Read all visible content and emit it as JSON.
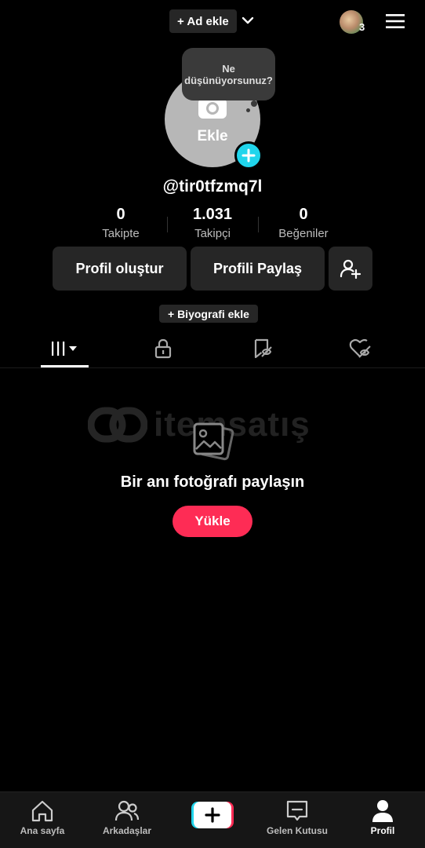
{
  "header": {
    "add_name_label": "+ Ad ekle",
    "notification_count": "3"
  },
  "profile": {
    "bubble_text": "Ne düşünüyorsunuz?",
    "avatar_label": "Ekle",
    "username": "@tir0tfzmq7l",
    "bio_button": "+ Biyografi ekle"
  },
  "stats": [
    {
      "value": "0",
      "label": "Takipte"
    },
    {
      "value": "1.031",
      "label": "Takipçi"
    },
    {
      "value": "0",
      "label": "Beğeniler"
    }
  ],
  "actions": {
    "edit_profile": "Profil oluştur",
    "share_profile": "Profili Paylaş"
  },
  "tabs": [
    {
      "icon": "grid-icon",
      "active": true
    },
    {
      "icon": "lock-icon",
      "active": false
    },
    {
      "icon": "bookmark-icon",
      "active": false
    },
    {
      "icon": "liked-icon",
      "active": false
    }
  ],
  "watermark": "itemsatış",
  "empty_state": {
    "title": "Bir anı fotoğrafı paylaşın",
    "upload_button": "Yükle"
  },
  "bottom_nav": {
    "home": "Ana sayfa",
    "friends": "Arkadaşlar",
    "inbox": "Gelen Kutusu",
    "profile": "Profil"
  },
  "colors": {
    "accent": "#fe2c55",
    "cyan": "#20d5ec",
    "background": "#000000",
    "surface": "#262626"
  }
}
